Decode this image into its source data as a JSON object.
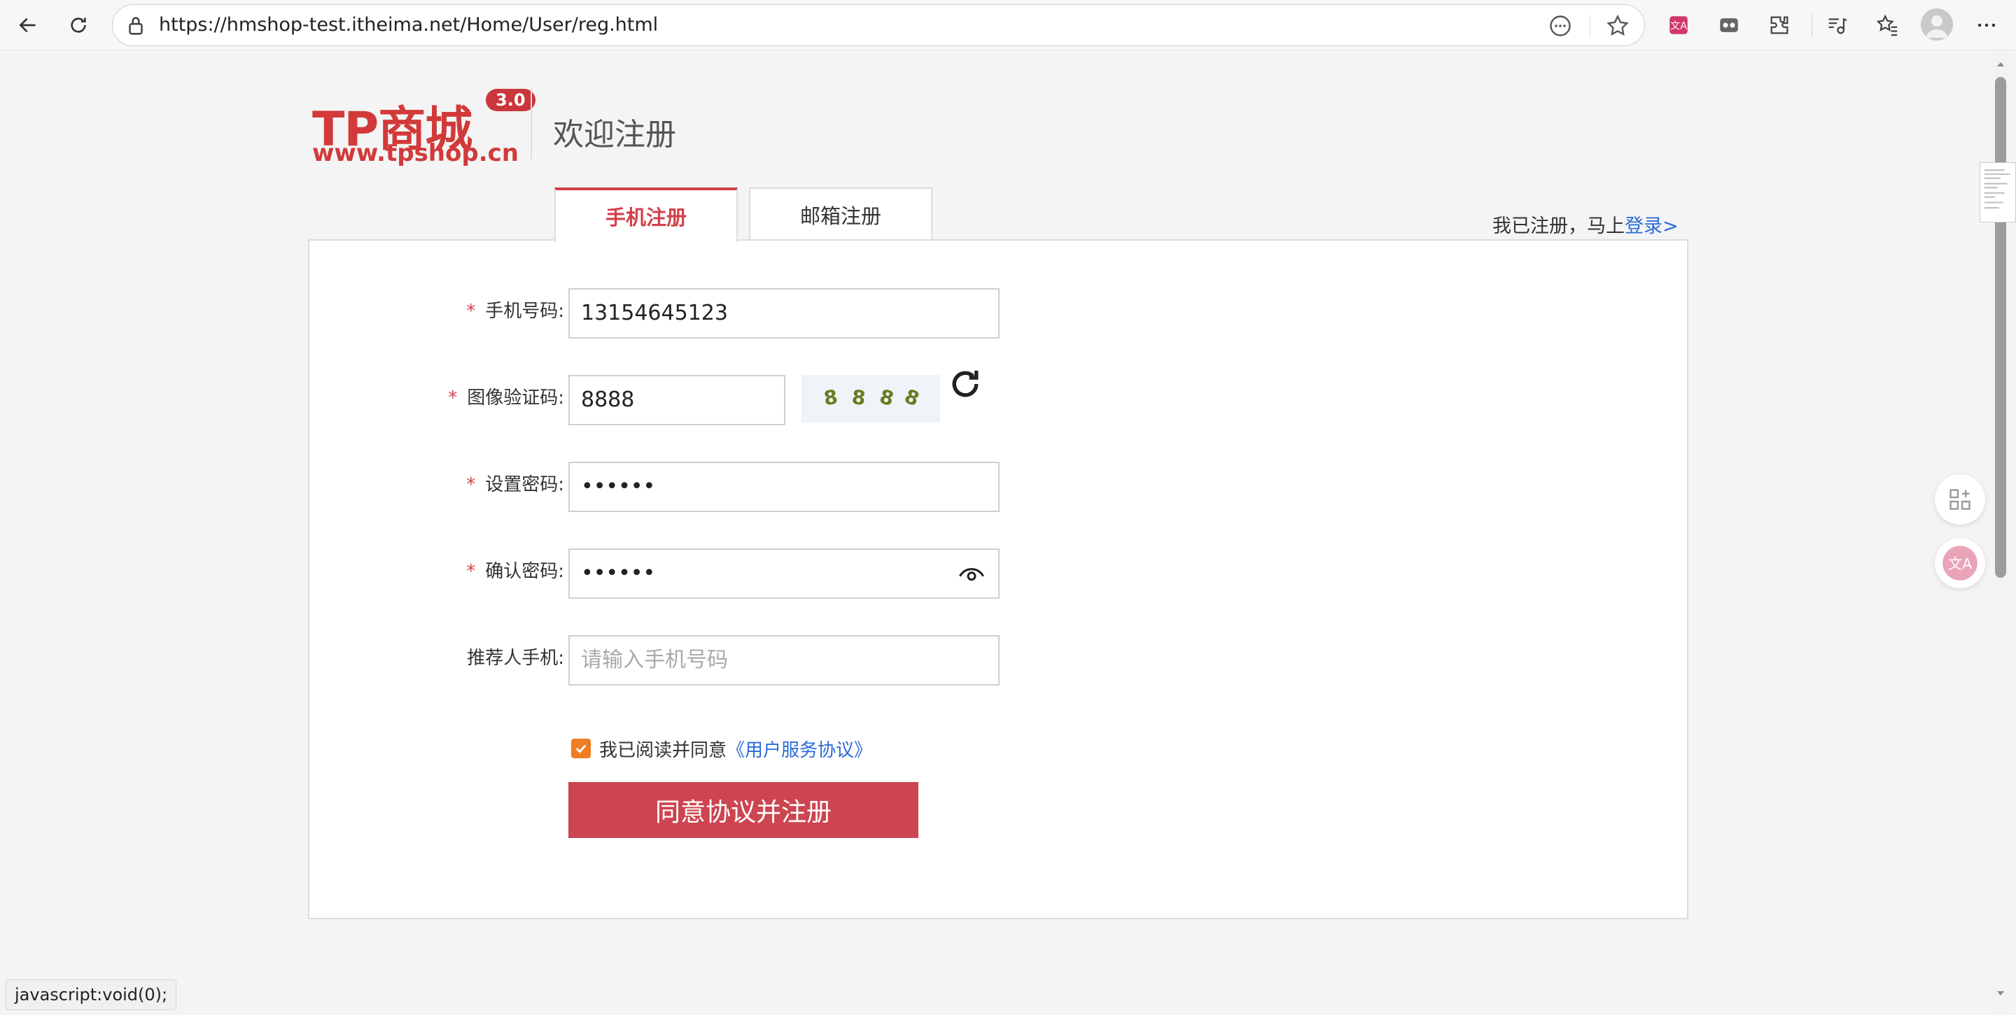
{
  "browser": {
    "url": "https://hmshop-test.itheima.net/Home/User/reg.html",
    "status_text": "javascript:void(0);"
  },
  "header": {
    "logo_text": "TP商城",
    "logo_version": "3.0",
    "logo_site": "www.tpshop.cn",
    "page_title": "欢迎注册"
  },
  "tabs": [
    {
      "label": "手机注册",
      "active": true
    },
    {
      "label": "邮箱注册",
      "active": false
    }
  ],
  "login_hint": {
    "prefix": "我已注册，马上",
    "link": "登录>"
  },
  "form": {
    "required_mark": "*",
    "phone": {
      "label": "手机号码:",
      "value": "13154645123"
    },
    "captcha": {
      "label": "图像验证码:",
      "value": "8888",
      "image_chars": [
        "8",
        "8",
        "8",
        "8"
      ]
    },
    "password": {
      "label": "设置密码:",
      "value": "••••••"
    },
    "confirm_password": {
      "label": "确认密码:",
      "value": "••••••"
    },
    "referrer": {
      "label": "推荐人手机:",
      "placeholder": "请输入手机号码"
    },
    "agreement": {
      "checked": true,
      "text": "我已阅读并同意",
      "link": "《用户服务协议》"
    },
    "submit_label": "同意协议并注册"
  },
  "colors": {
    "brand_red": "#d2414b",
    "link_blue": "#2a6bd8",
    "checkbox_orange": "#ee7d23"
  },
  "icons": [
    "back-icon",
    "refresh-icon",
    "lock-icon",
    "more-icon",
    "star-icon",
    "translate-icon",
    "extensions-icon",
    "puzzle-icon",
    "media-icon",
    "favorites-icon",
    "avatar-icon",
    "menu-icon",
    "captcha-refresh-icon",
    "eye-icon",
    "apps-icon"
  ]
}
